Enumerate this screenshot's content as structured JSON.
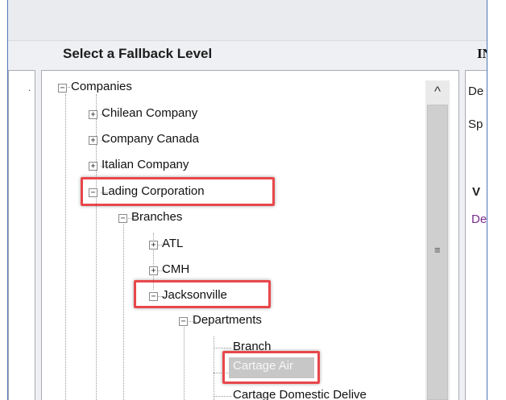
{
  "panel_title": "Select a Fallback Level",
  "right_panel": {
    "heading_fragment": "INC",
    "line1": "De",
    "line2": "Sp",
    "line3": "V",
    "line4": "De"
  },
  "tree": {
    "root": "Companies",
    "companies": [
      "Chilean Company",
      "Company Canada",
      "Italian Company",
      "Lading Corporation"
    ],
    "branches_label": "Branches",
    "branches": [
      "ATL",
      "CMH",
      "Jacksonville"
    ],
    "departments_label": "Departments",
    "departments": [
      "Branch",
      "Cartage Air",
      "Cartage Domestic Delive"
    ]
  },
  "selected_item": "Cartage Air",
  "highlight_color": "#e8474b"
}
